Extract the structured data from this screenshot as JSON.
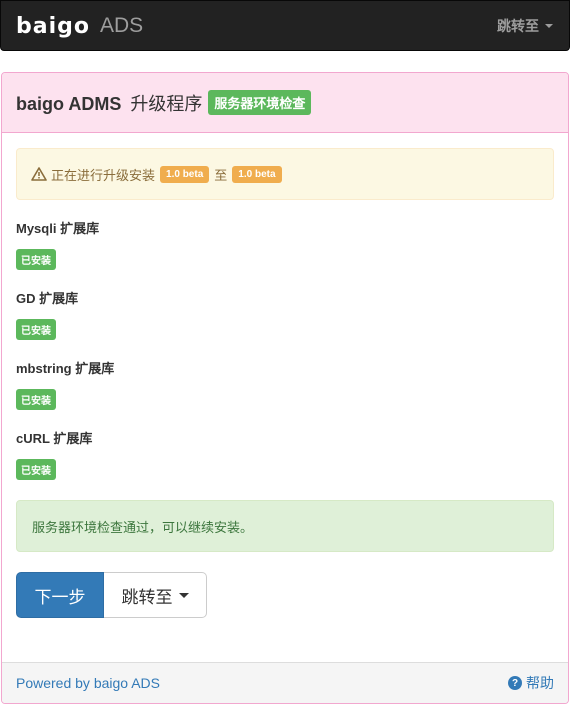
{
  "navbar": {
    "logo_text": "baigo",
    "brand_suffix": "ADS",
    "jump_label": "跳转至"
  },
  "panel": {
    "title": "baigo ADMS",
    "title_suffix": "升级程序",
    "badge": "服务器环境检查"
  },
  "upgrade_alert": {
    "prefix": "正在进行升级安装",
    "from_version": "1.0 beta",
    "middle": "至",
    "to_version": "1.0 beta",
    "icon": "warning-icon"
  },
  "extensions": [
    {
      "name": "Mysqli 扩展库",
      "status": "已安装"
    },
    {
      "name": "GD 扩展库",
      "status": "已安装"
    },
    {
      "name": "mbstring 扩展库",
      "status": "已安装"
    },
    {
      "name": "cURL 扩展库",
      "status": "已安装"
    }
  ],
  "success_alert": "服务器环境检查通过，可以继续安装。",
  "buttons": {
    "next": "下一步",
    "jump": "跳转至"
  },
  "footer": {
    "powered": "Powered by baigo ADS",
    "help": "帮助",
    "help_icon": "question-circle-icon"
  },
  "colors": {
    "panel_border": "#f2a7cf",
    "panel_heading_bg": "#fde2ef",
    "success": "#5cb85c",
    "warning": "#f0ad4e",
    "primary": "#337ab7"
  }
}
